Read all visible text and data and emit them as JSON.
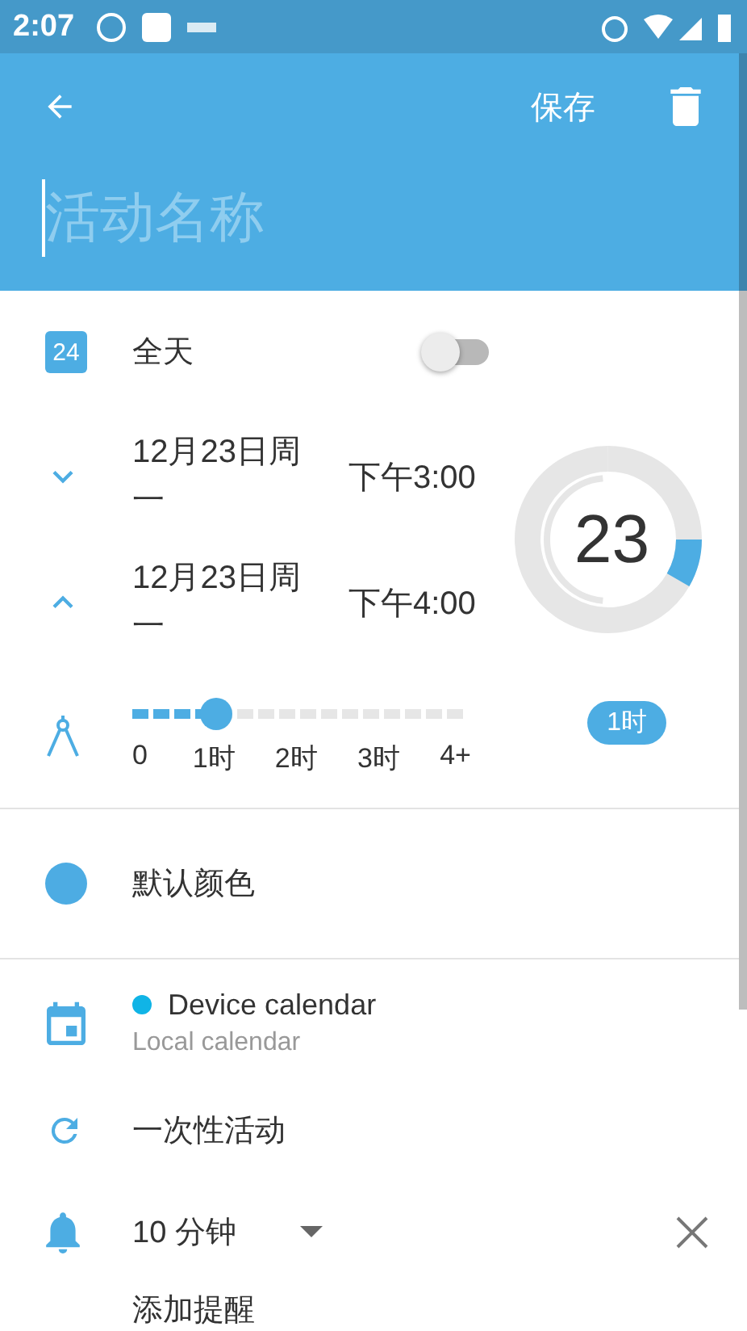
{
  "status_bar": {
    "time": "2:07"
  },
  "toolbar": {
    "save": "保存"
  },
  "title_field": {
    "placeholder": "活动名称"
  },
  "all_day": {
    "icon_text": "24",
    "label": "全天",
    "on": false
  },
  "start": {
    "date": "12月23日周一",
    "time": "下午3:00"
  },
  "end": {
    "date": "12月23日周一",
    "time": "下午4:00"
  },
  "dial": {
    "day": "23"
  },
  "duration": {
    "level": 0.25,
    "labels": [
      "0",
      "1时",
      "2时",
      "3时",
      "4+"
    ],
    "chip": "1时"
  },
  "color": {
    "label": "默认颜色",
    "color": "#4dace3"
  },
  "calendar": {
    "name": "Device calendar",
    "account": "Local calendar",
    "color": "#10b4e6"
  },
  "repeat": {
    "label": "一次性活动"
  },
  "reminder": {
    "value": "10 分钟",
    "add": "添加提醒"
  }
}
